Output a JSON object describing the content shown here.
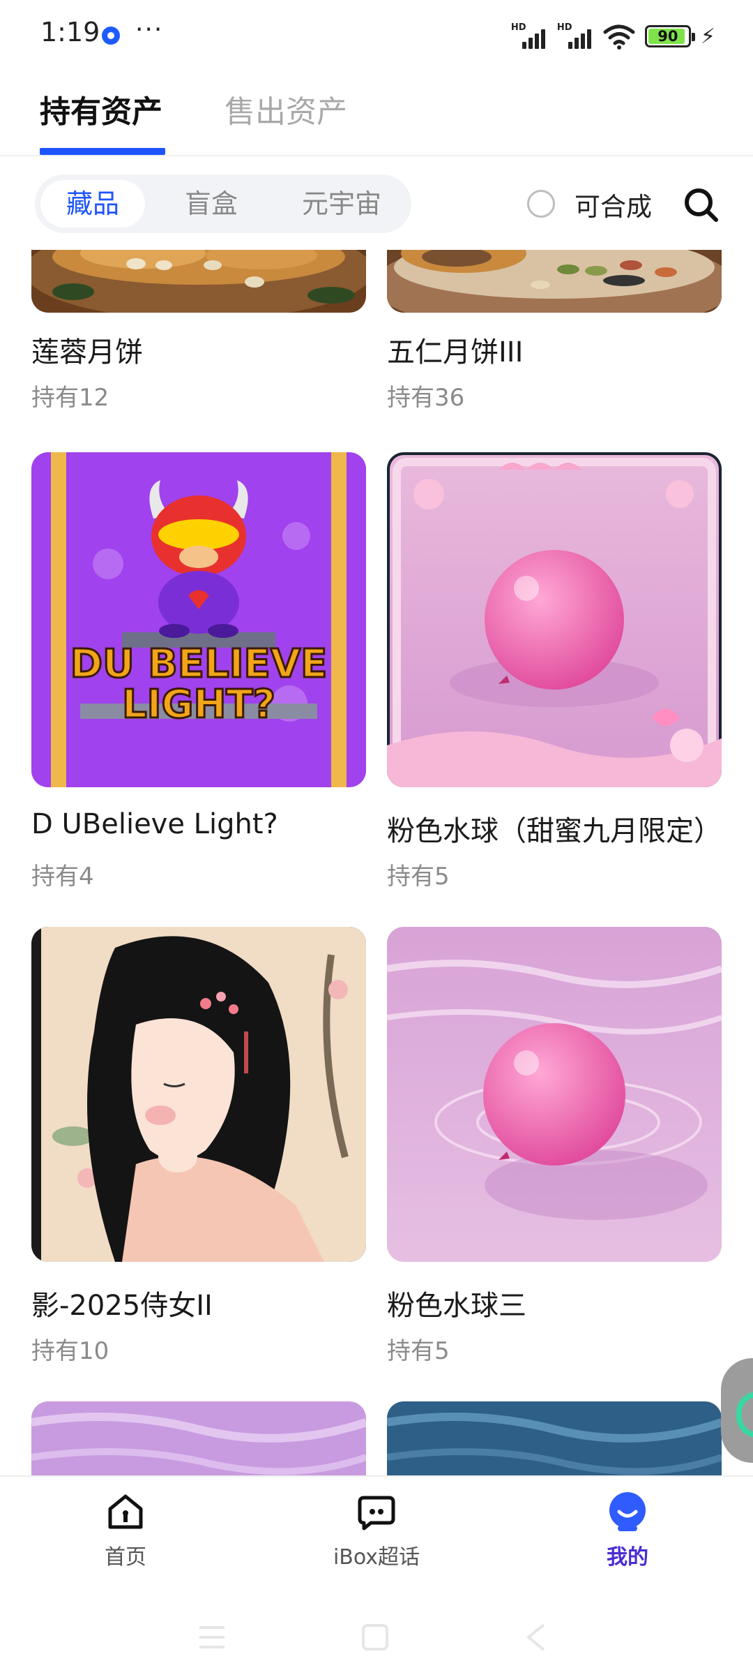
{
  "status_bar": {
    "time": "1:19",
    "more": "···",
    "battery": "90",
    "signal_labels": [
      "HD",
      "HD"
    ]
  },
  "tabs": {
    "active": "持有资产",
    "inactive": "售出资产"
  },
  "filters": {
    "segments": [
      "藏品",
      "盲盒",
      "元宇宙"
    ],
    "combine_label": "可合成"
  },
  "items": [
    {
      "title": "莲蓉月饼",
      "count": "持有12"
    },
    {
      "title": "五仁月饼III",
      "count": "持有36"
    },
    {
      "title": "D UBelieve Light?",
      "count": "持有4",
      "art_line1": "DU BELIEVE",
      "art_line2": "LIGHT?"
    },
    {
      "title": "粉色水球（甜蜜九月限定）",
      "count": "持有5"
    },
    {
      "title": "影-2025侍女II",
      "count": "持有10"
    },
    {
      "title": "粉色水球三",
      "count": "持有5"
    }
  ],
  "bottom_nav": {
    "home": "首页",
    "chat": "iBox超话",
    "me": "我的"
  },
  "colors": {
    "accent": "#1e55ff",
    "nav_active": "#4a2bd4"
  }
}
